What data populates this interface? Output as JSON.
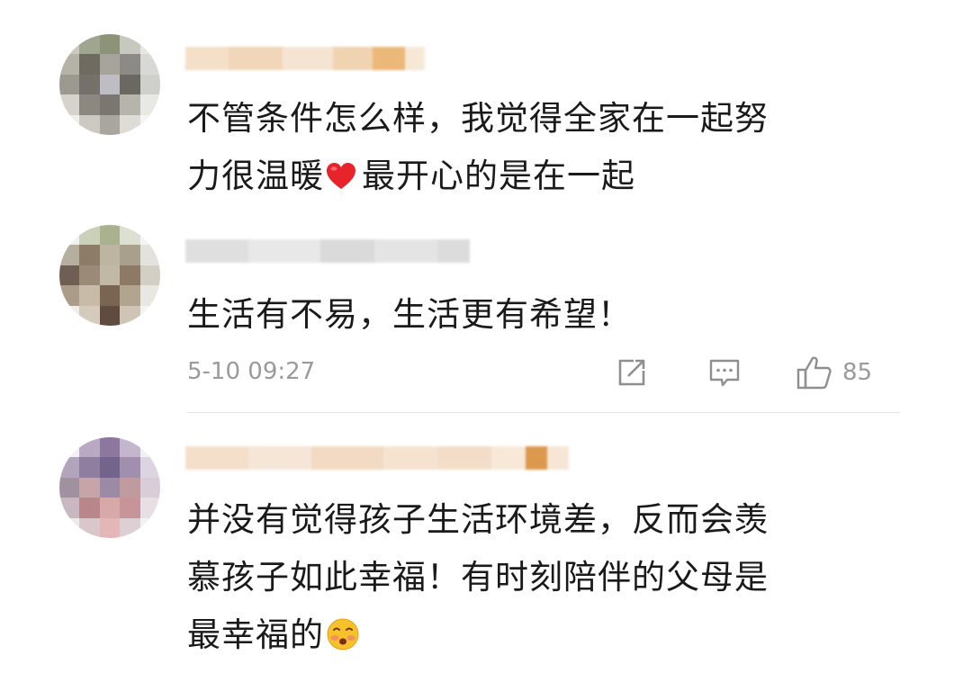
{
  "comments": [
    {
      "text_lines": [
        "不管条件怎么样，我觉得全家在一起努",
        "力很温暖",
        "最开心的是在一起"
      ],
      "emoji": "red-heart"
    },
    {
      "text_lines": [
        "生活有不易，生活更有希望！"
      ],
      "timestamp": "5-10 09:27",
      "actions": {
        "share_icon": "share-icon",
        "comment_icon": "comment-icon",
        "like_icon": "thumbs-up-icon",
        "like_count": "85"
      }
    },
    {
      "text_lines": [
        "并没有觉得孩子生活环境差，反而会羡",
        "慕孩子如此幸福！有时刻陪伴的父母是",
        "最幸福的"
      ],
      "emoji": "smiling-face-with-blush"
    }
  ],
  "colors": {
    "text": "#1a1a1a",
    "meta": "#9a9a9a",
    "heart": "#e8242b",
    "divider": "#e4e4e4"
  }
}
